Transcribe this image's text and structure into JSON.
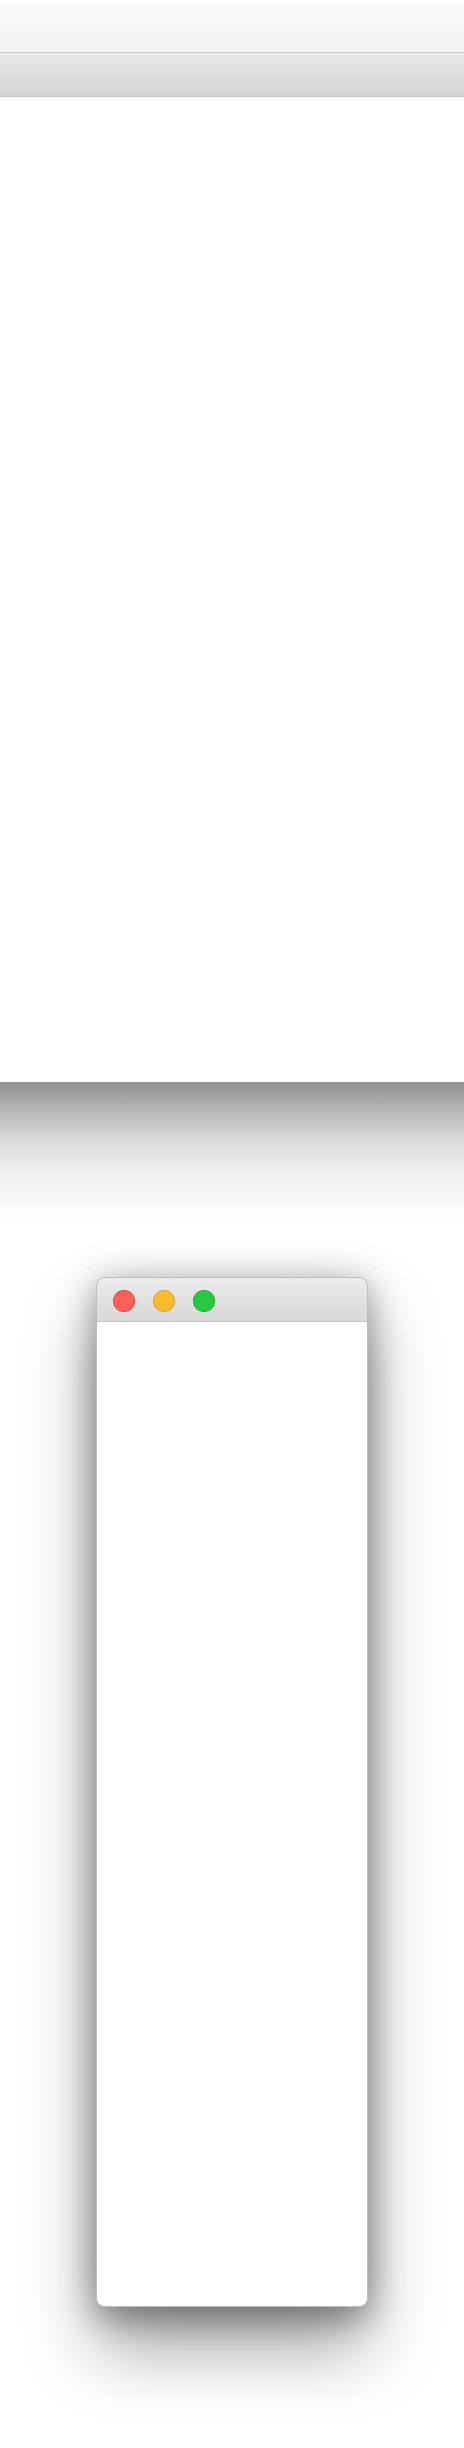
{
  "background_window": {
    "titlebar_color": "#d4d4d4",
    "content_color": "#ffffff"
  },
  "foreground_window": {
    "traffic_lights": [
      {
        "name": "close-button",
        "color": "#fe5f57"
      },
      {
        "name": "minimize-button",
        "color": "#febb2e"
      },
      {
        "name": "zoom-button",
        "color": "#28c840"
      }
    ],
    "titlebar_color": "#d8d8d8",
    "content_color": "#ffffff"
  }
}
